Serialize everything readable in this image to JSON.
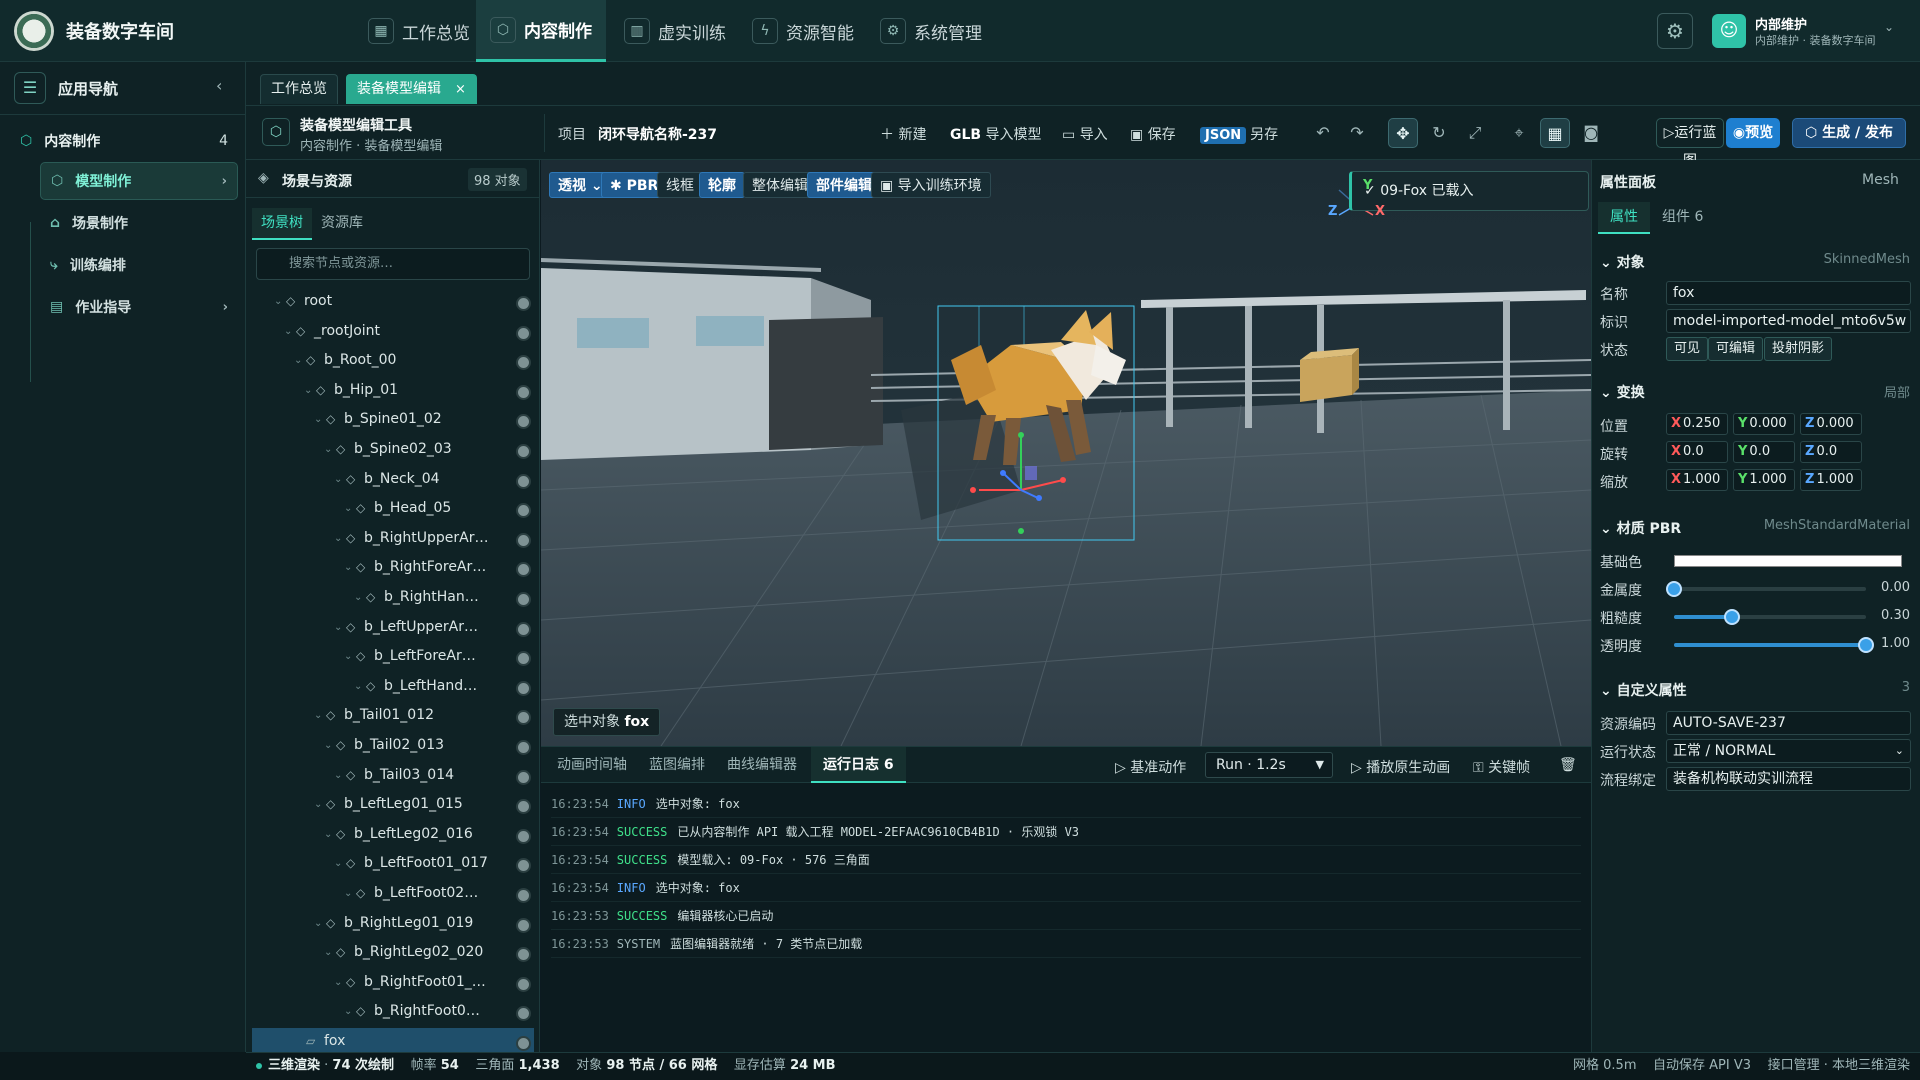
{
  "app": {
    "title": "装备数字车间"
  },
  "main_nav": [
    {
      "label": "工作总览",
      "icon": "grid-icon"
    },
    {
      "label": "内容制作",
      "icon": "cube-icon",
      "active": true
    },
    {
      "label": "虚实训练",
      "icon": "book-icon"
    },
    {
      "label": "资源智能",
      "icon": "lightning-icon"
    },
    {
      "label": "系统管理",
      "icon": "gear-icon"
    }
  ],
  "user": {
    "name": "内部维护",
    "subtitle": "内部维护 · 装备数字车间"
  },
  "left_nav": {
    "title": "应用导航",
    "group": {
      "label": "内容制作",
      "count": "4"
    },
    "items": [
      {
        "label": "模型制作",
        "active": true
      },
      {
        "label": "场景制作"
      },
      {
        "label": "训练编排"
      },
      {
        "label": "作业指导"
      }
    ]
  },
  "doc_tabs": [
    {
      "label": "工作总览"
    },
    {
      "label": "装备模型编辑",
      "active": true,
      "close": "×"
    }
  ],
  "toolbar": {
    "tool_name": "装备模型编辑工具",
    "tool_path": "内容制作 · 装备模型编辑",
    "project_label": "项目",
    "project_name": "闭环导航名称-237",
    "new_label": "新建",
    "import_model_prefix": "GLB",
    "import_model_label": "导入模型",
    "import_label": "导入",
    "save_label": "保存",
    "json_badge": "JSON",
    "save_as_label": "另存",
    "run_label": "运行蓝图",
    "preview_label": "预览",
    "publish_label": "生成 / 发布"
  },
  "scene_panel": {
    "title": "场景与资源",
    "count": "98 对象",
    "tabs": [
      "场景树",
      "资源库"
    ],
    "search_placeholder": "搜索节点或资源…",
    "tree": [
      {
        "label": "root",
        "depth": 0
      },
      {
        "label": "_rootJoint",
        "depth": 1
      },
      {
        "label": "b_Root_00",
        "depth": 2
      },
      {
        "label": "b_Hip_01",
        "depth": 3
      },
      {
        "label": "b_Spine01_02",
        "depth": 4
      },
      {
        "label": "b_Spine02_03",
        "depth": 5
      },
      {
        "label": "b_Neck_04",
        "depth": 6
      },
      {
        "label": "b_Head_05",
        "depth": 7
      },
      {
        "label": "b_RightUpperAr…",
        "depth": 6
      },
      {
        "label": "b_RightForeAr…",
        "depth": 7
      },
      {
        "label": "b_RightHan…",
        "depth": 8
      },
      {
        "label": "b_LeftUpperAr…",
        "depth": 6
      },
      {
        "label": "b_LeftForeAr…",
        "depth": 7
      },
      {
        "label": "b_LeftHand…",
        "depth": 8
      },
      {
        "label": "b_Tail01_012",
        "depth": 4
      },
      {
        "label": "b_Tail02_013",
        "depth": 5
      },
      {
        "label": "b_Tail03_014",
        "depth": 6
      },
      {
        "label": "b_LeftLeg01_015",
        "depth": 4
      },
      {
        "label": "b_LeftLeg02_016",
        "depth": 5
      },
      {
        "label": "b_LeftFoot01_017",
        "depth": 6
      },
      {
        "label": "b_LeftFoot02…",
        "depth": 7
      },
      {
        "label": "b_RightLeg01_019",
        "depth": 4
      },
      {
        "label": "b_RightLeg02_020",
        "depth": 5
      },
      {
        "label": "b_RightFoot01_…",
        "depth": 6
      },
      {
        "label": "b_RightFoot0…",
        "depth": 7
      },
      {
        "label": "fox",
        "depth": 2,
        "selected": true
      }
    ]
  },
  "viewport": {
    "tools": [
      {
        "label": "透视",
        "on": true
      },
      {
        "label": "✱ PBR",
        "on": true
      },
      {
        "label": "线框"
      },
      {
        "label": "轮廓",
        "on": true
      },
      {
        "label": "整体编辑"
      },
      {
        "label": "部件编辑",
        "on": true
      },
      {
        "label": "▣ 导入训练环境"
      }
    ],
    "toast": "09-Fox 已载入",
    "selected_label": "选中对象",
    "selected_value": "fox",
    "axes": {
      "y": "Y",
      "z": "Z",
      "x": "X"
    }
  },
  "bottom_panel": {
    "tabs": [
      "动画时间轴",
      "蓝图编排",
      "曲线编辑器",
      "运行日志 6"
    ],
    "base_action": "基准动作",
    "run_select": "Run · 1.2s",
    "play_native": "播放原生动画",
    "keyframe": "关键帧",
    "logs": [
      {
        "time": "16:23:54",
        "level": "INFO",
        "msg": "选中对象: fox"
      },
      {
        "time": "16:23:54",
        "level": "SUCCESS",
        "msg": "已从内容制作 API 载入工程 MODEL-2EFAAC9610CB4B1D · 乐观锁 V3"
      },
      {
        "time": "16:23:54",
        "level": "SUCCESS",
        "msg": "模型载入: 09-Fox · 576 三角面"
      },
      {
        "time": "16:23:54",
        "level": "INFO",
        "msg": "选中对象: fox"
      },
      {
        "time": "16:23:53",
        "level": "SUCCESS",
        "msg": "编辑器核心已启动"
      },
      {
        "time": "16:23:53",
        "level": "SYSTEM",
        "msg": "蓝图编辑器就绪 · 7 类节点已加载"
      }
    ]
  },
  "props_panel": {
    "title": "属性面板",
    "type": "Mesh",
    "tabs": [
      "属性",
      "组件 6"
    ],
    "object_section": "对象",
    "object_type": "SkinnedMesh",
    "name_label": "名称",
    "name_value": "fox",
    "id_label": "标识",
    "id_value": "model-imported-model_mto6v5w",
    "state_label": "状态",
    "states": [
      "可见",
      "可编辑",
      "投射阴影"
    ],
    "transform_section": "变换",
    "transform_space": "局部",
    "position_label": "位置",
    "position": [
      "0.250",
      "0.000",
      "0.000"
    ],
    "rotation_label": "旋转",
    "rotation": [
      "0.0",
      "0.0",
      "0.0"
    ],
    "scale_label": "缩放",
    "scale": [
      "1.000",
      "1.000",
      "1.000"
    ],
    "axis_labels": [
      "X",
      "Y",
      "Z"
    ],
    "axis_colors": [
      "#ff5a5a",
      "#5ae06a",
      "#5aa8ff"
    ],
    "material_section": "材质 PBR",
    "material_type": "MeshStandardMaterial",
    "base_color_label": "基础色",
    "base_color": "#ffffff",
    "metalness_label": "金属度",
    "metalness": "0.00",
    "roughness_label": "粗糙度",
    "roughness": "0.30",
    "opacity_label": "透明度",
    "opacity": "1.00",
    "custom_section": "自定义属性",
    "custom_count": "3",
    "asset_code_label": "资源编码",
    "asset_code": "AUTO-SAVE-237",
    "run_state_label": "运行状态",
    "run_state": "正常 / NORMAL",
    "flow_label": "流程绑定",
    "flow_value": "装备机构联动实训流程"
  },
  "status_bar": {
    "render": "三维渲染",
    "draw_calls": "74 次绘制",
    "fps_label": "帧率",
    "fps": "54",
    "tri_label": "三角面",
    "tris": "1,438",
    "obj_label": "对象",
    "objs": "98 节点 / 66 网格",
    "mem_label": "显存估算",
    "mem": "24 MB",
    "grid": "网格 0.5m",
    "autosave": "自动保存 API V3",
    "api": "接口管理",
    "local": "本地三维渲染"
  },
  "colors": {
    "accent": "#2fc3a8",
    "primary": "#1e7fd0",
    "background": "#0c1a20"
  }
}
